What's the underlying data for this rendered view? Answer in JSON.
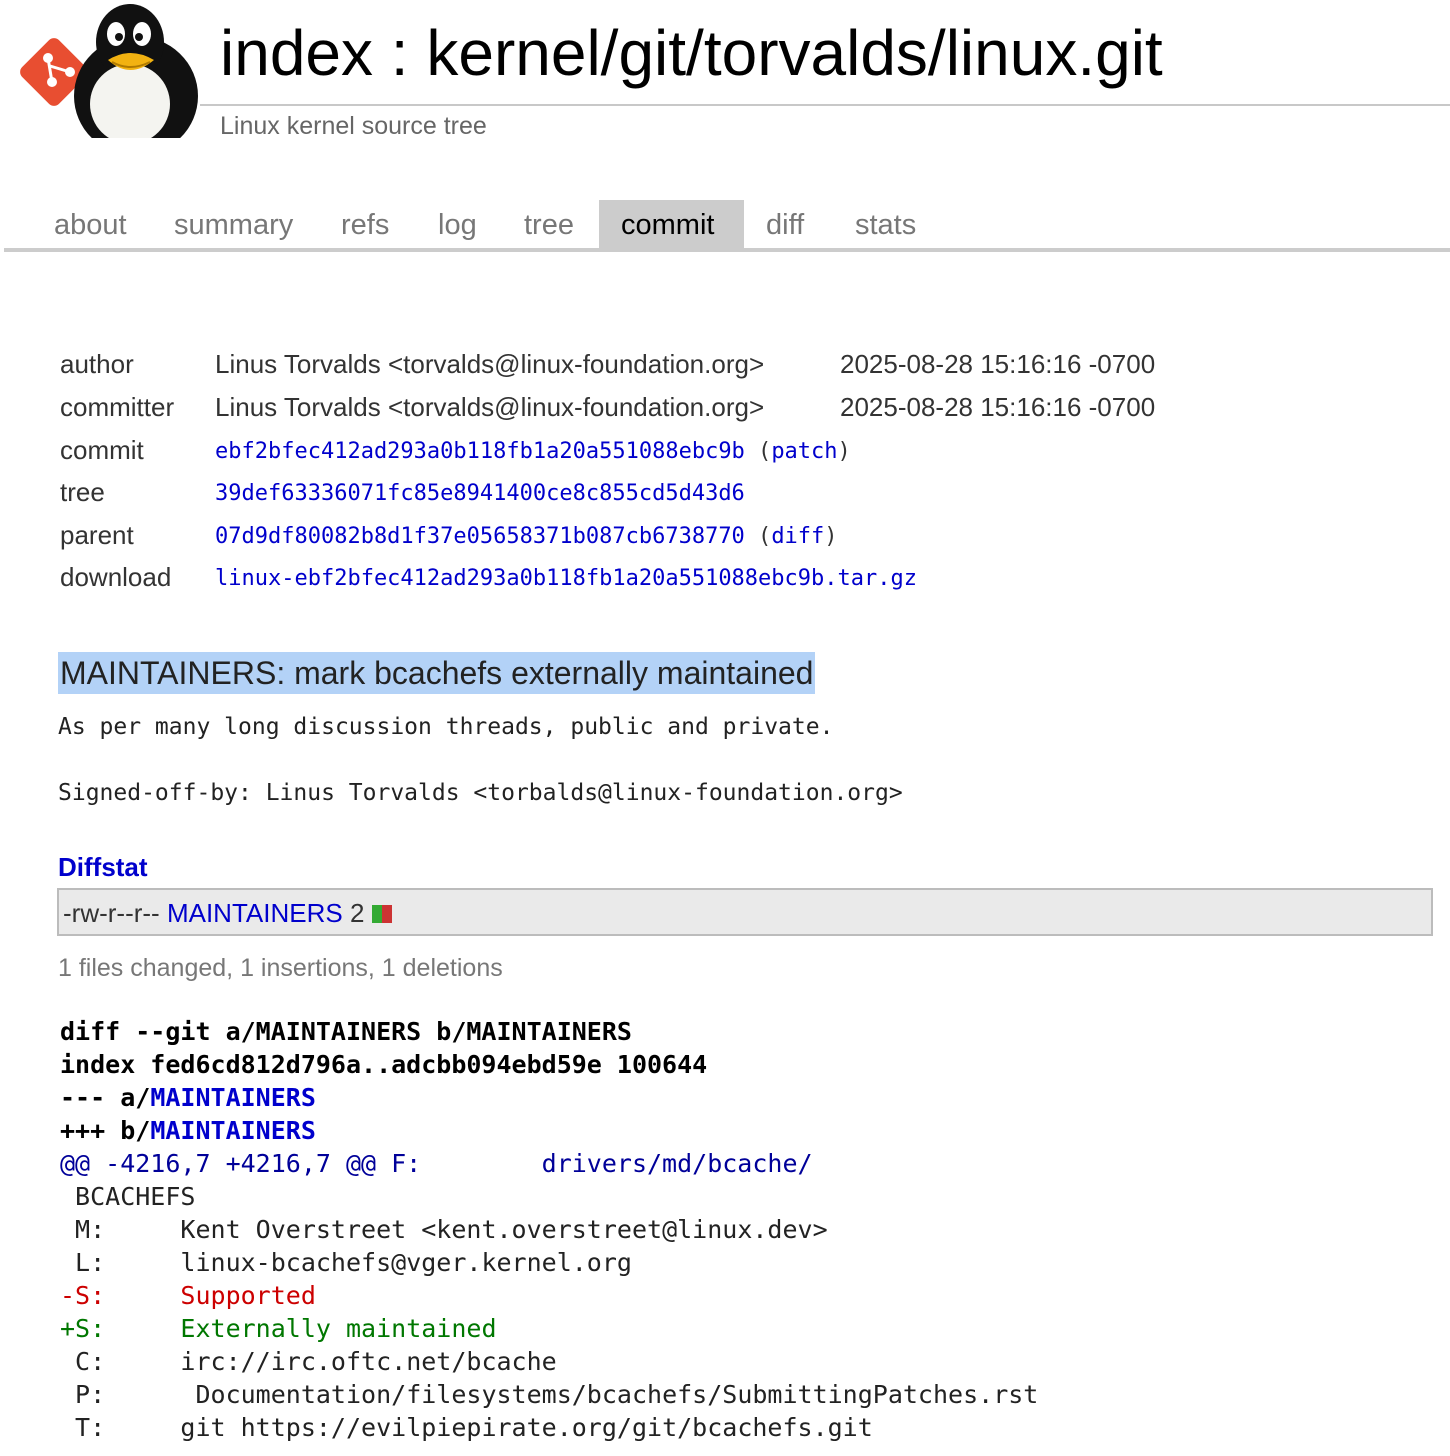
{
  "header": {
    "title": "index : kernel/git/torvalds/linux.git",
    "description": "Linux kernel source tree"
  },
  "tabs": [
    {
      "label": "about"
    },
    {
      "label": "summary"
    },
    {
      "label": "refs"
    },
    {
      "label": "log"
    },
    {
      "label": "tree"
    },
    {
      "label": "commit",
      "active": true
    },
    {
      "label": "diff"
    },
    {
      "label": "stats"
    }
  ],
  "commit_info": {
    "author": {
      "key": "author",
      "name": "Linus Torvalds <torvalds@linux-foundation.org>",
      "date": "2025-08-28 15:16:16 -0700"
    },
    "committer": {
      "key": "committer",
      "name": "Linus Torvalds <torvalds@linux-foundation.org>",
      "date": "2025-08-28 15:16:16 -0700"
    },
    "commit": {
      "key": "commit",
      "hash": "ebf2bfec412ad293a0b118fb1a20a551088ebc9b",
      "extra_label": "patch"
    },
    "tree": {
      "key": "tree",
      "hash": "39def63336071fc85e8941400ce8c855cd5d43d6"
    },
    "parent": {
      "key": "parent",
      "hash": "07d9df80082b8d1f37e05658371b087cb6738770",
      "extra_label": "diff"
    },
    "download": {
      "key": "download",
      "file": "linux-ebf2bfec412ad293a0b118fb1a20a551088ebc9b.tar.gz"
    }
  },
  "message": {
    "subject": "MAINTAINERS: mark bcachefs externally maintained",
    "body": "As per many long discussion threads, public and private.",
    "signoff": "Signed-off-by: Linus Torvalds <torbalds@linux-foundation.org>"
  },
  "diffstat": {
    "header": "Diffstat",
    "mode": "-rw-r--r--",
    "file": "MAINTAINERS",
    "changes": "2",
    "add_color": "#33aa33",
    "del_color": "#cc3333",
    "summary": "1 files changed, 1 insertions, 1 deletions"
  },
  "diff": {
    "header_line": "diff --git a/MAINTAINERS b/MAINTAINERS",
    "index_line": "index fed6cd812d796a..adcbb094ebd59e 100644",
    "minus_prefix": "--- a/",
    "plus_prefix": "+++ b/",
    "file": "MAINTAINERS",
    "hunk": "@@ -4216,7 +4216,7 @@ F:\tdrivers/md/bcache/",
    "lines": [
      {
        "type": "ctx",
        "text": " BCACHEFS"
      },
      {
        "type": "ctx",
        "text": " M:\tKent Overstreet <kent.overstreet@linux.dev>"
      },
      {
        "type": "ctx",
        "text": " L:\tlinux-bcachefs@vger.kernel.org"
      },
      {
        "type": "del",
        "text": "-S:\tSupported"
      },
      {
        "type": "add",
        "text": "+S:\tExternally maintained"
      },
      {
        "type": "ctx",
        "text": " C:\tirc://irc.oftc.net/bcache"
      },
      {
        "type": "ctx",
        "text": " P:\t Documentation/filesystems/bcachefs/SubmittingPatches.rst"
      },
      {
        "type": "ctx",
        "text": " T:\tgit https://evilpiepirate.org/git/bcachefs.git"
      }
    ]
  }
}
